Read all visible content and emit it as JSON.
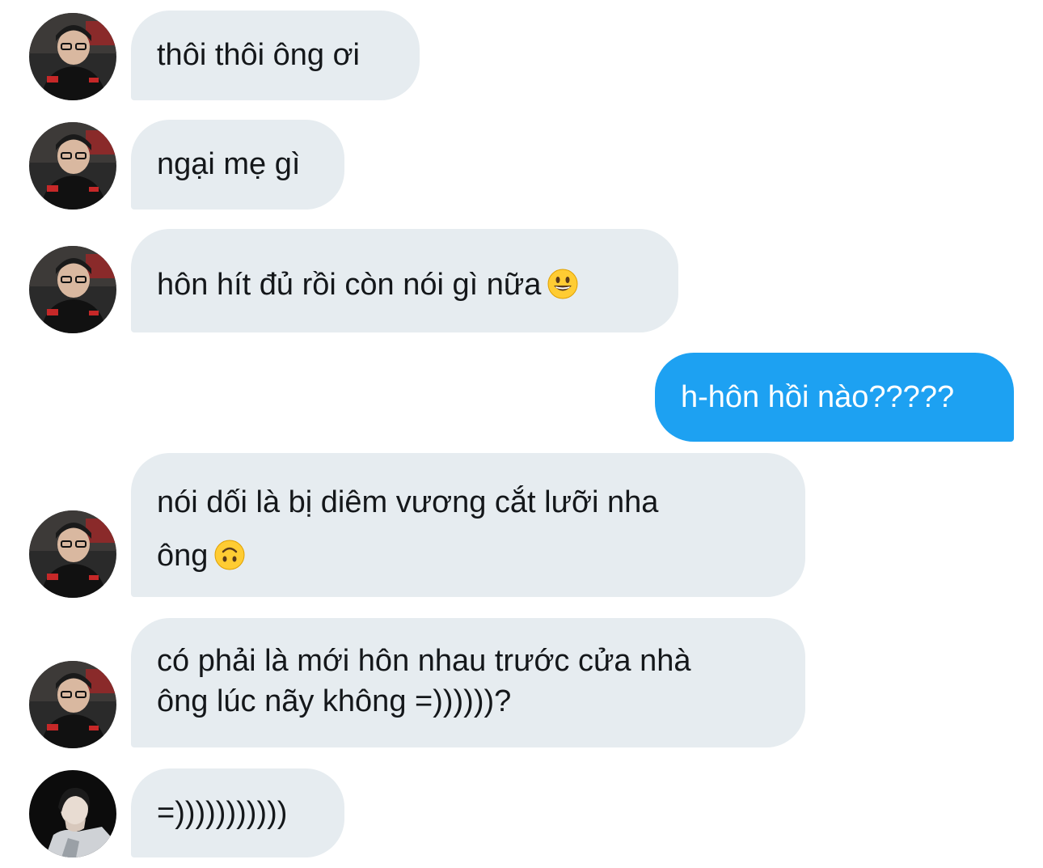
{
  "messages": [
    {
      "id": "m1",
      "direction": "incoming",
      "lines": [
        "thôi thôi ông ơi"
      ]
    },
    {
      "id": "m2",
      "direction": "incoming",
      "lines": [
        "ngại mẹ gì"
      ]
    },
    {
      "id": "m3",
      "direction": "incoming",
      "lines": [
        "hôn hít đủ rồi còn nói gì nữa"
      ],
      "emoji": "grinning-face-emoji"
    },
    {
      "id": "m4",
      "direction": "outgoing",
      "lines": [
        "h-hôn hồi nào?????"
      ]
    },
    {
      "id": "m5",
      "direction": "incoming",
      "lines": [
        "nói dối là bị diêm vương cắt lưỡi nha",
        "ông"
      ],
      "emoji": "upside-down-face-emoji"
    },
    {
      "id": "m6",
      "direction": "incoming",
      "lines": [
        "có phải là mới hôn nhau trước cửa nhà",
        "ông lúc nãy không =))))))?"
      ]
    },
    {
      "id": "m7",
      "direction": "incoming",
      "lines": [
        "=)))))))))))"
      ]
    }
  ],
  "colors": {
    "incoming_bubble": "#e6ecf0",
    "outgoing_bubble": "#1da1f2",
    "incoming_text": "#14171a",
    "outgoing_text": "#ffffff"
  },
  "avatars": {
    "sender_a": "avatar-gamer-with-glasses",
    "sender_b": "avatar-profile-dark"
  }
}
